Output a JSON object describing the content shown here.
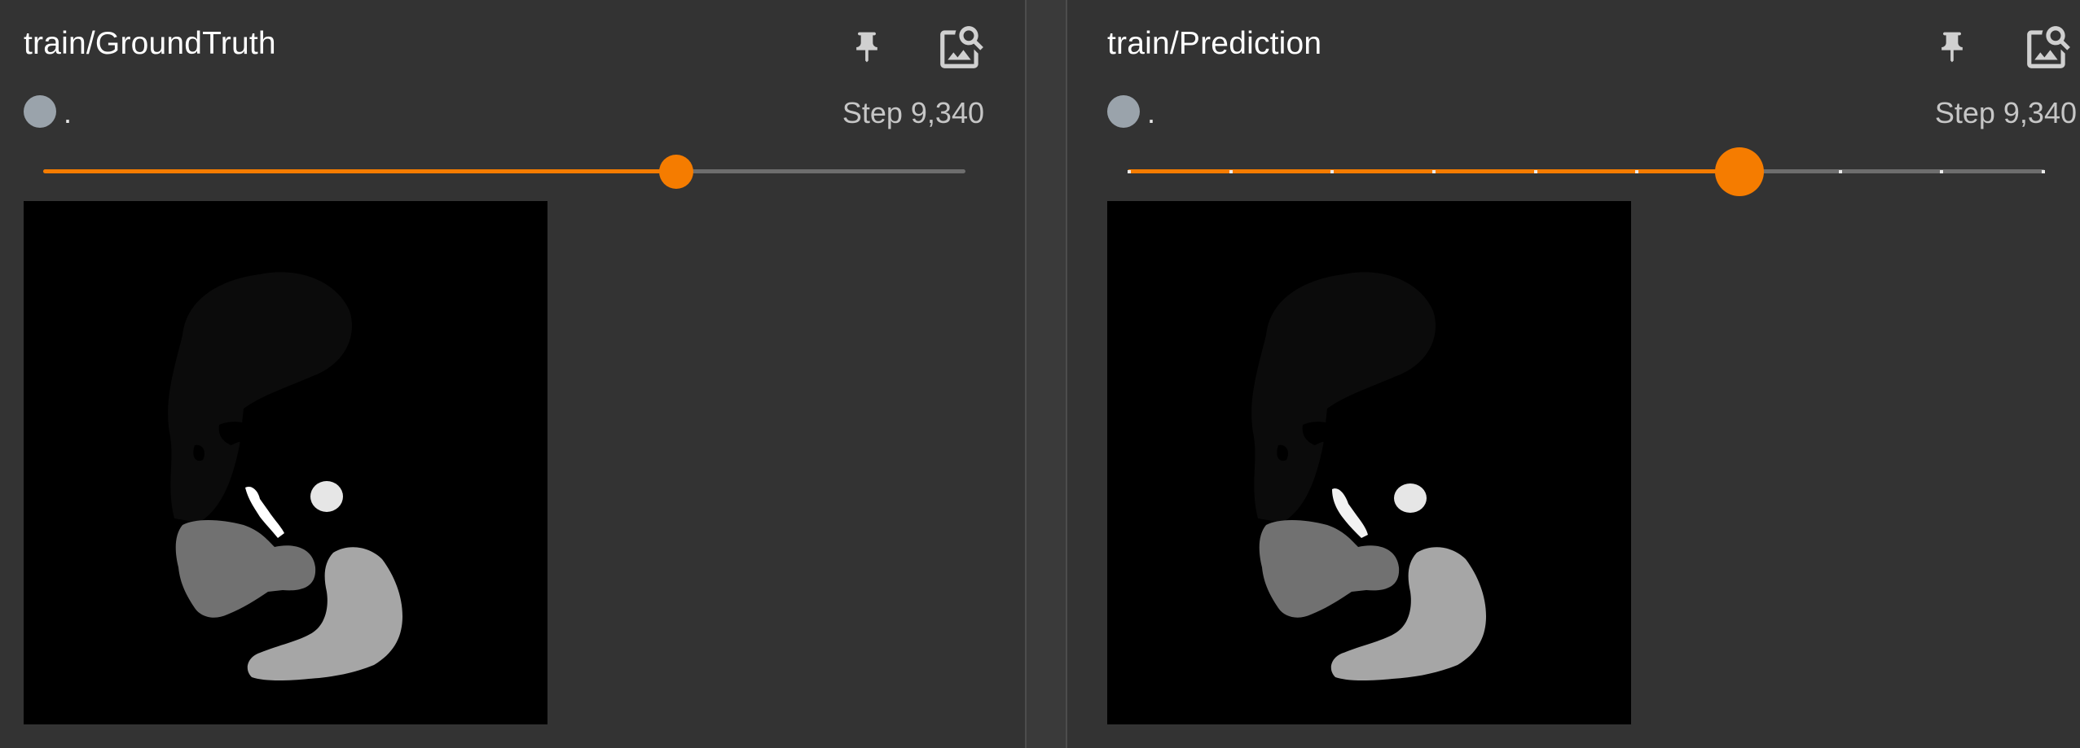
{
  "panels": [
    {
      "title": "train/GroundTruth",
      "run_name": ".",
      "step_label": "Step 9,340",
      "slider_value_fraction": 0.686,
      "slider_ticks": false,
      "icons": [
        "pin-icon",
        "image-search-icon"
      ]
    },
    {
      "title": "train/Prediction",
      "run_name": ".",
      "step_label": "Step 9,340",
      "slider_value_fraction": 0.667,
      "slider_ticks": true,
      "icons": [
        "pin-icon",
        "image-search-icon"
      ]
    }
  ],
  "colors": {
    "background": "#333333",
    "accent": "#f57c00",
    "run_dot": "#9aa3ab",
    "track_inactive": "#6e6e6e"
  }
}
